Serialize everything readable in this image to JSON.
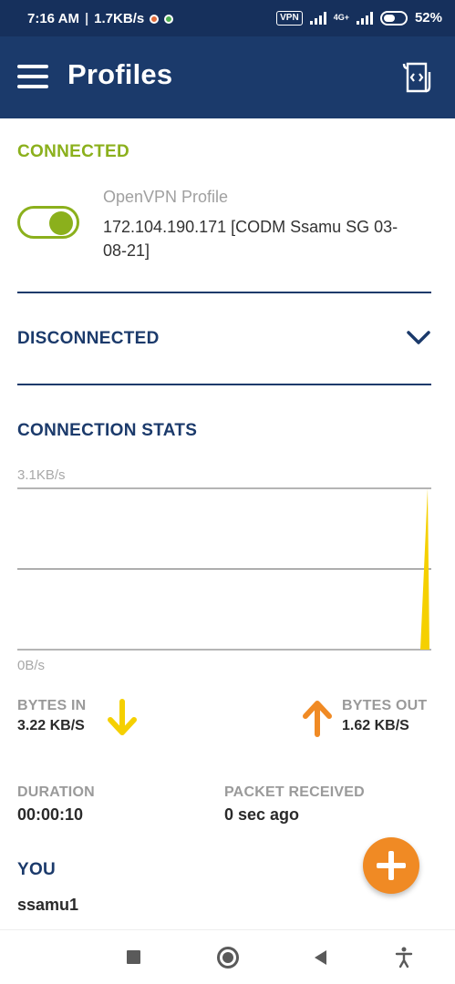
{
  "status_bar": {
    "time": "7:16 AM",
    "speed": "1.7KB/s",
    "vpn_badge": "VPN",
    "network": "4G+",
    "battery": "52%"
  },
  "app_bar": {
    "title": "Profiles"
  },
  "connected": {
    "label": "CONNECTED",
    "profile_name": "OpenVPN Profile",
    "profile_detail": "172.104.190.171 [CODM Ssamu SG 03-08-21]",
    "toggle_on": true
  },
  "disconnected": {
    "label": "DISCONNECTED"
  },
  "stats": {
    "label": "CONNECTION STATS",
    "bytes_in_label": "BYTES IN",
    "bytes_in_value": "3.22 KB/S",
    "bytes_out_label": "BYTES OUT",
    "bytes_out_value": "1.62 KB/S",
    "duration_label": "DURATION",
    "duration_value": "00:00:10",
    "packet_label": "PACKET RECEIVED",
    "packet_value": "0 sec ago",
    "you_label": "YOU",
    "you_value": "ssamu1"
  },
  "chart_data": {
    "type": "area",
    "y_max_label": "3.1KB/s",
    "y_min_label": "0B/s",
    "ylim": [
      0,
      3.1
    ],
    "series": [
      {
        "values": [
          0,
          0,
          0,
          0,
          0,
          0,
          0,
          0,
          0,
          0,
          3.1
        ]
      }
    ],
    "grid": true
  },
  "colors": {
    "primary": "#1b3a6b",
    "connected_green": "#8bb01c",
    "accent_orange": "#f08a24",
    "chart_yellow": "#f5d000"
  },
  "icons": {
    "menu": "hamburger-icon",
    "import": "import-profile-icon",
    "expand": "chevron-down-icon",
    "bytes_in": "arrow-down-icon",
    "bytes_out": "arrow-up-icon",
    "add": "plus-icon"
  }
}
